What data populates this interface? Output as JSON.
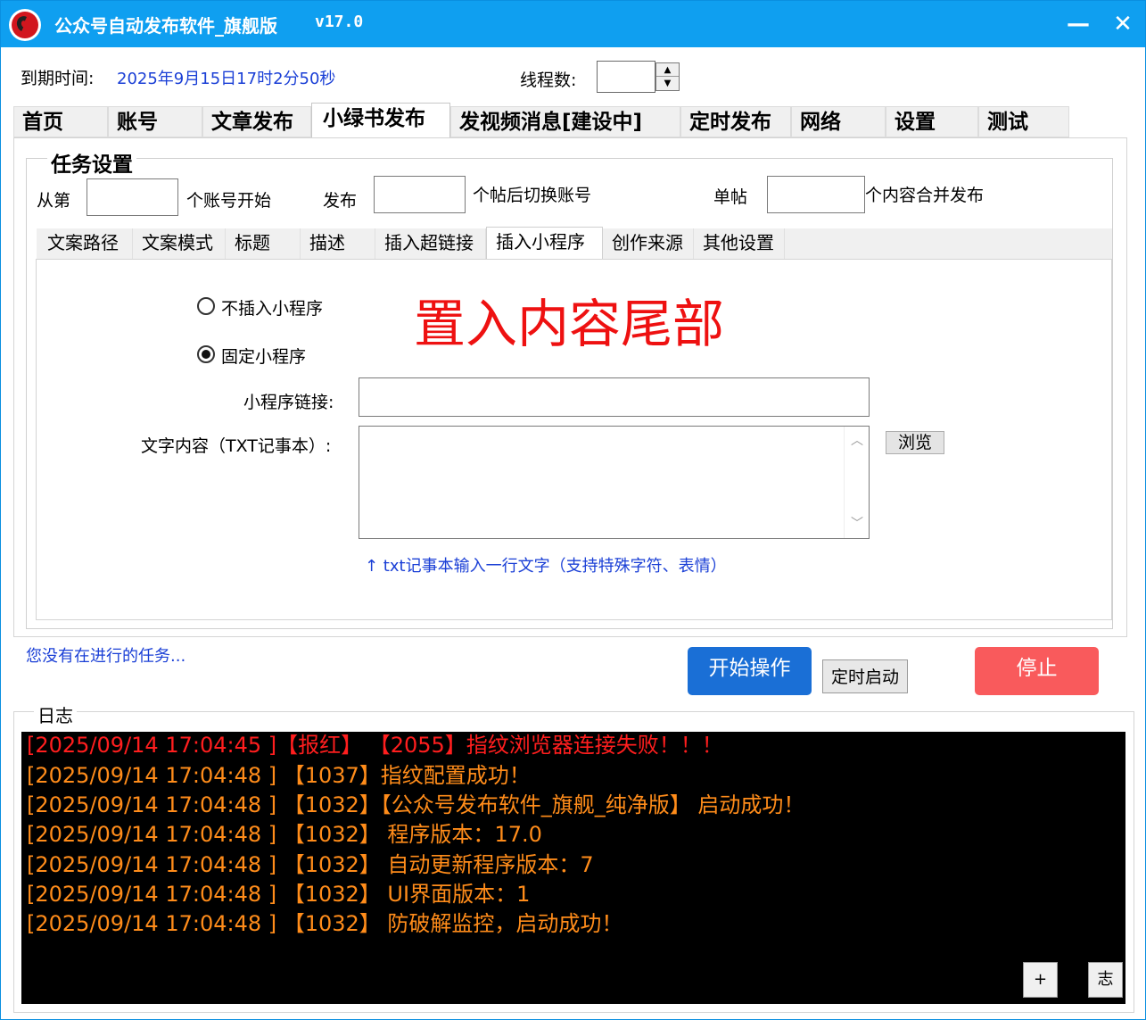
{
  "window": {
    "title": "公众号自动发布软件_旗舰版",
    "version": "v17.0",
    "minimize": "—",
    "close": "✕"
  },
  "info": {
    "expire_label": "到期时间:",
    "expire_value": "2025年9月15日17时2分50秒",
    "thread_label": "线程数:",
    "thread_value": ""
  },
  "main_tabs": [
    "首页",
    "账号",
    "文章发布",
    "小绿书发布",
    "发视频消息[建设中]",
    "定时发布",
    "网络",
    "设置",
    "测试"
  ],
  "task": {
    "title": "任务设置",
    "from_label": "从第",
    "from_value": "",
    "account_start": "个账号开始",
    "publish_label": "发布",
    "publish_value": "",
    "switch_label": "个帖后切换账号",
    "single_label": "单帖",
    "single_value": "",
    "merge_label": "个内容合并发布"
  },
  "sub_tabs": [
    "文案路径",
    "文案模式",
    "标题",
    "描述",
    "插入超链接",
    "插入小程序",
    "创作来源",
    "其他设置"
  ],
  "mini": {
    "option_none": "不插入小程序",
    "option_fixed": "固定小程序",
    "big_notice": "置入内容尾部",
    "link_label": "小程序链接:",
    "link_value": "",
    "text_label": "文字内容（TXT记事本）:",
    "text_value": "",
    "browse": "浏览",
    "hint": "↑ txt记事本输入一行文字（支持特殊字符、表情）"
  },
  "status": {
    "text": "您没有在进行的任务...",
    "start": "开始操作",
    "timer": "定时启动",
    "stop": "停止"
  },
  "log": {
    "title": "日志",
    "lines": [
      {
        "text": "[2025/09/14 17:04:45 ]【报红】 【2055】指纹浏览器连接失败！！！",
        "color": "#ff1e1e"
      },
      {
        "text": "[2025/09/14 17:04:48 ] 【1037】指纹配置成功！",
        "color": "#ff8c1a"
      },
      {
        "text": "[2025/09/14 17:04:48 ] 【1032】【公众号发布软件_旗舰_纯净版】 启动成功！",
        "color": "#ff8c1a"
      },
      {
        "text": "[2025/09/14 17:04:48 ] 【1032】 程序版本：17.0",
        "color": "#ff8c1a"
      },
      {
        "text": "[2025/09/14 17:04:48 ] 【1032】 自动更新程序版本：7",
        "color": "#ff8c1a"
      },
      {
        "text": "[2025/09/14 17:04:48 ] 【1032】 UI界面版本：1",
        "color": "#ff8c1a"
      },
      {
        "text": "[2025/09/14 17:04:48 ] 【1032】 防破解监控，启动成功！",
        "color": "#ff8c1a"
      }
    ],
    "plus_btn": "+",
    "log_btn": "志"
  },
  "colors": {
    "titlebar": "#0f9ff0",
    "link_blue": "#1a3fd6",
    "start_button": "#1a6fd6",
    "stop_button": "#f95a5c",
    "notice_red": "#ee1111"
  }
}
